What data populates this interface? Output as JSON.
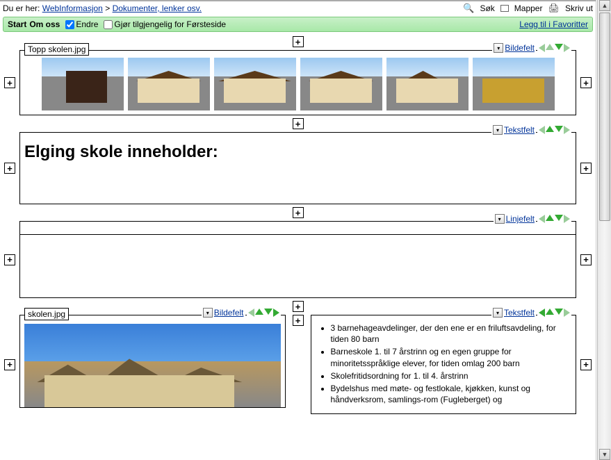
{
  "breadcrumb": {
    "prefix": "Du er her:",
    "link1": "WebInformasjon",
    "sep": ">",
    "link2": "Dokumenter, lenker osv."
  },
  "topright": {
    "sok": "Søk",
    "mapper": "Mapper",
    "skriv_ut": "Skriv ut"
  },
  "greenbar": {
    "tab_start": "Start",
    "tab_omoss": "Om oss",
    "cb_endre": "Endre",
    "cb_forside": "Gjør tilgjengelig for Førsteside",
    "favoritter": "Legg til i Favoritter"
  },
  "field_types": {
    "bildefelt": "Bildefelt",
    "tekstfelt": "Tekstfelt",
    "linjefelt": "Linjefelt"
  },
  "panel1": {
    "filename": "Topp skolen.jpg"
  },
  "panel2": {
    "heading": "Elging skole inneholder:"
  },
  "panel4": {
    "filename": "skolen.jpg"
  },
  "panel5": {
    "bullets": [
      "3 barnehageavdelinger, der den ene er en friluftsavdeling, for tiden 80 barn",
      "Barneskole 1. til 7 årstrinn og en egen gruppe for minoritetsspråklige elever, for tiden omlag 200 barn",
      "Skolefritidsordning for 1. til 4. årstrinn",
      "Bydelshus med møte- og festlokale, kjøkken, kunst og håndverksrom, samlings-rom (Fugleberget) og"
    ]
  }
}
